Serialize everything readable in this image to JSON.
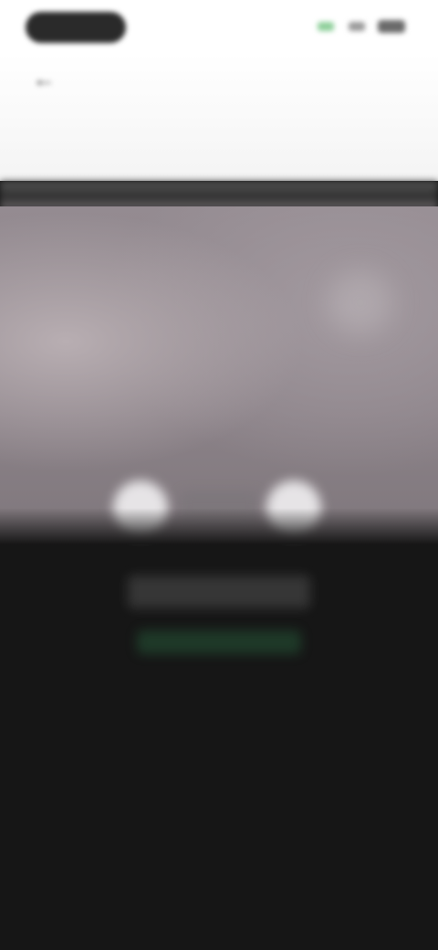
{
  "app": {
    "title": ""
  },
  "status_bar": {
    "time": "",
    "icons": [
      "signal-icon",
      "wifi-icon",
      "battery-icon"
    ]
  },
  "header": {
    "back_icon": "back-arrow-icon",
    "back_glyph": "←",
    "title": "",
    "tabs": [
      {
        "label": ""
      },
      {
        "label": ""
      },
      {
        "label": ""
      },
      {
        "label": ""
      },
      {
        "label": ""
      }
    ]
  },
  "preview": {
    "left_control_icon": "circle-button-icon",
    "right_control_icon": "circle-button-icon",
    "center_label": ""
  },
  "content": {
    "caption": "",
    "action_link": ""
  },
  "colors": {
    "background": "#161616",
    "header": "#ffffff",
    "preview": "#8b8288",
    "accent": "#2e7a4a"
  }
}
